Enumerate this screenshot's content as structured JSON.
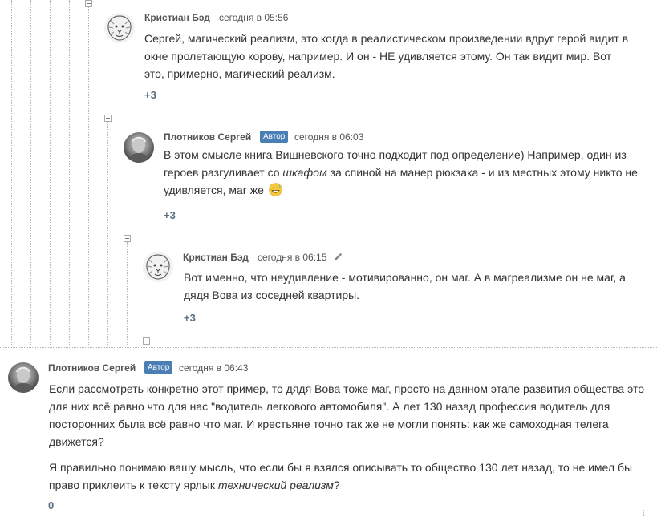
{
  "comments": [
    {
      "author": "Кристиан Бэд",
      "time": "сегодня в 05:56",
      "text": "Сергей, магический реализм, это когда в реалистическом произведении вдруг герой видит в окне пролетающую корову, например. И он - НЕ удивляется этому. Он так видит мир. Вот это, примерно, магический реализм.",
      "rating": "+3",
      "avatar_icon": "lion-sketch-avatar"
    },
    {
      "author": "Плотников Сергей",
      "badge": "Автор",
      "time": "сегодня в 06:03",
      "text_before": "В этом смысле книга Вишневского точно подходит под определение) Например, один из героев разгуливает со ",
      "text_em": "шкафом",
      "text_after": " за спиной на манер рюкзака - и из местных этому никто не удивляется, маг же",
      "emoji": "grinning-sweat-emoji",
      "rating": "+3",
      "avatar_icon": "portrait-photo-avatar"
    },
    {
      "author": "Кристиан Бэд",
      "time": "сегодня в 06:15",
      "edit_icon": "pencil-icon",
      "text": "Вот именно, что неудивление - мотивированно, он маг. А в магреализме он не маг, а дядя Вова из соседней квартиры.",
      "rating": "+3",
      "avatar_icon": "lion-sketch-avatar"
    },
    {
      "author": "Плотников Сергей",
      "badge": "Автор",
      "time": "сегодня в 06:43",
      "p1": "Если рассмотреть конкретно этот пример, то дядя Вова тоже маг, просто на данном этапе развития общества это для них всё равно что для нас \"водитель легкового автомобиля\". А лет 130 назад профессия водитель для посторонних была всё равно что маг. И крестьяне точно так же не могли понять: как же самоходная телега движется?",
      "p2_before": "Я правильно понимаю вашу мысль, что если бы я взялся описывать то общество 130 лет назад, то не имел бы право приклеить к тексту ярлык ",
      "p2_em": "технический реализм",
      "p2_after": "?",
      "rating": "0",
      "avatar_icon": "portrait-photo-avatar"
    }
  ],
  "colors": {
    "badge": "#4a7fb5",
    "rating": "#5a6e84",
    "thread_line": "#b5b5b5"
  }
}
